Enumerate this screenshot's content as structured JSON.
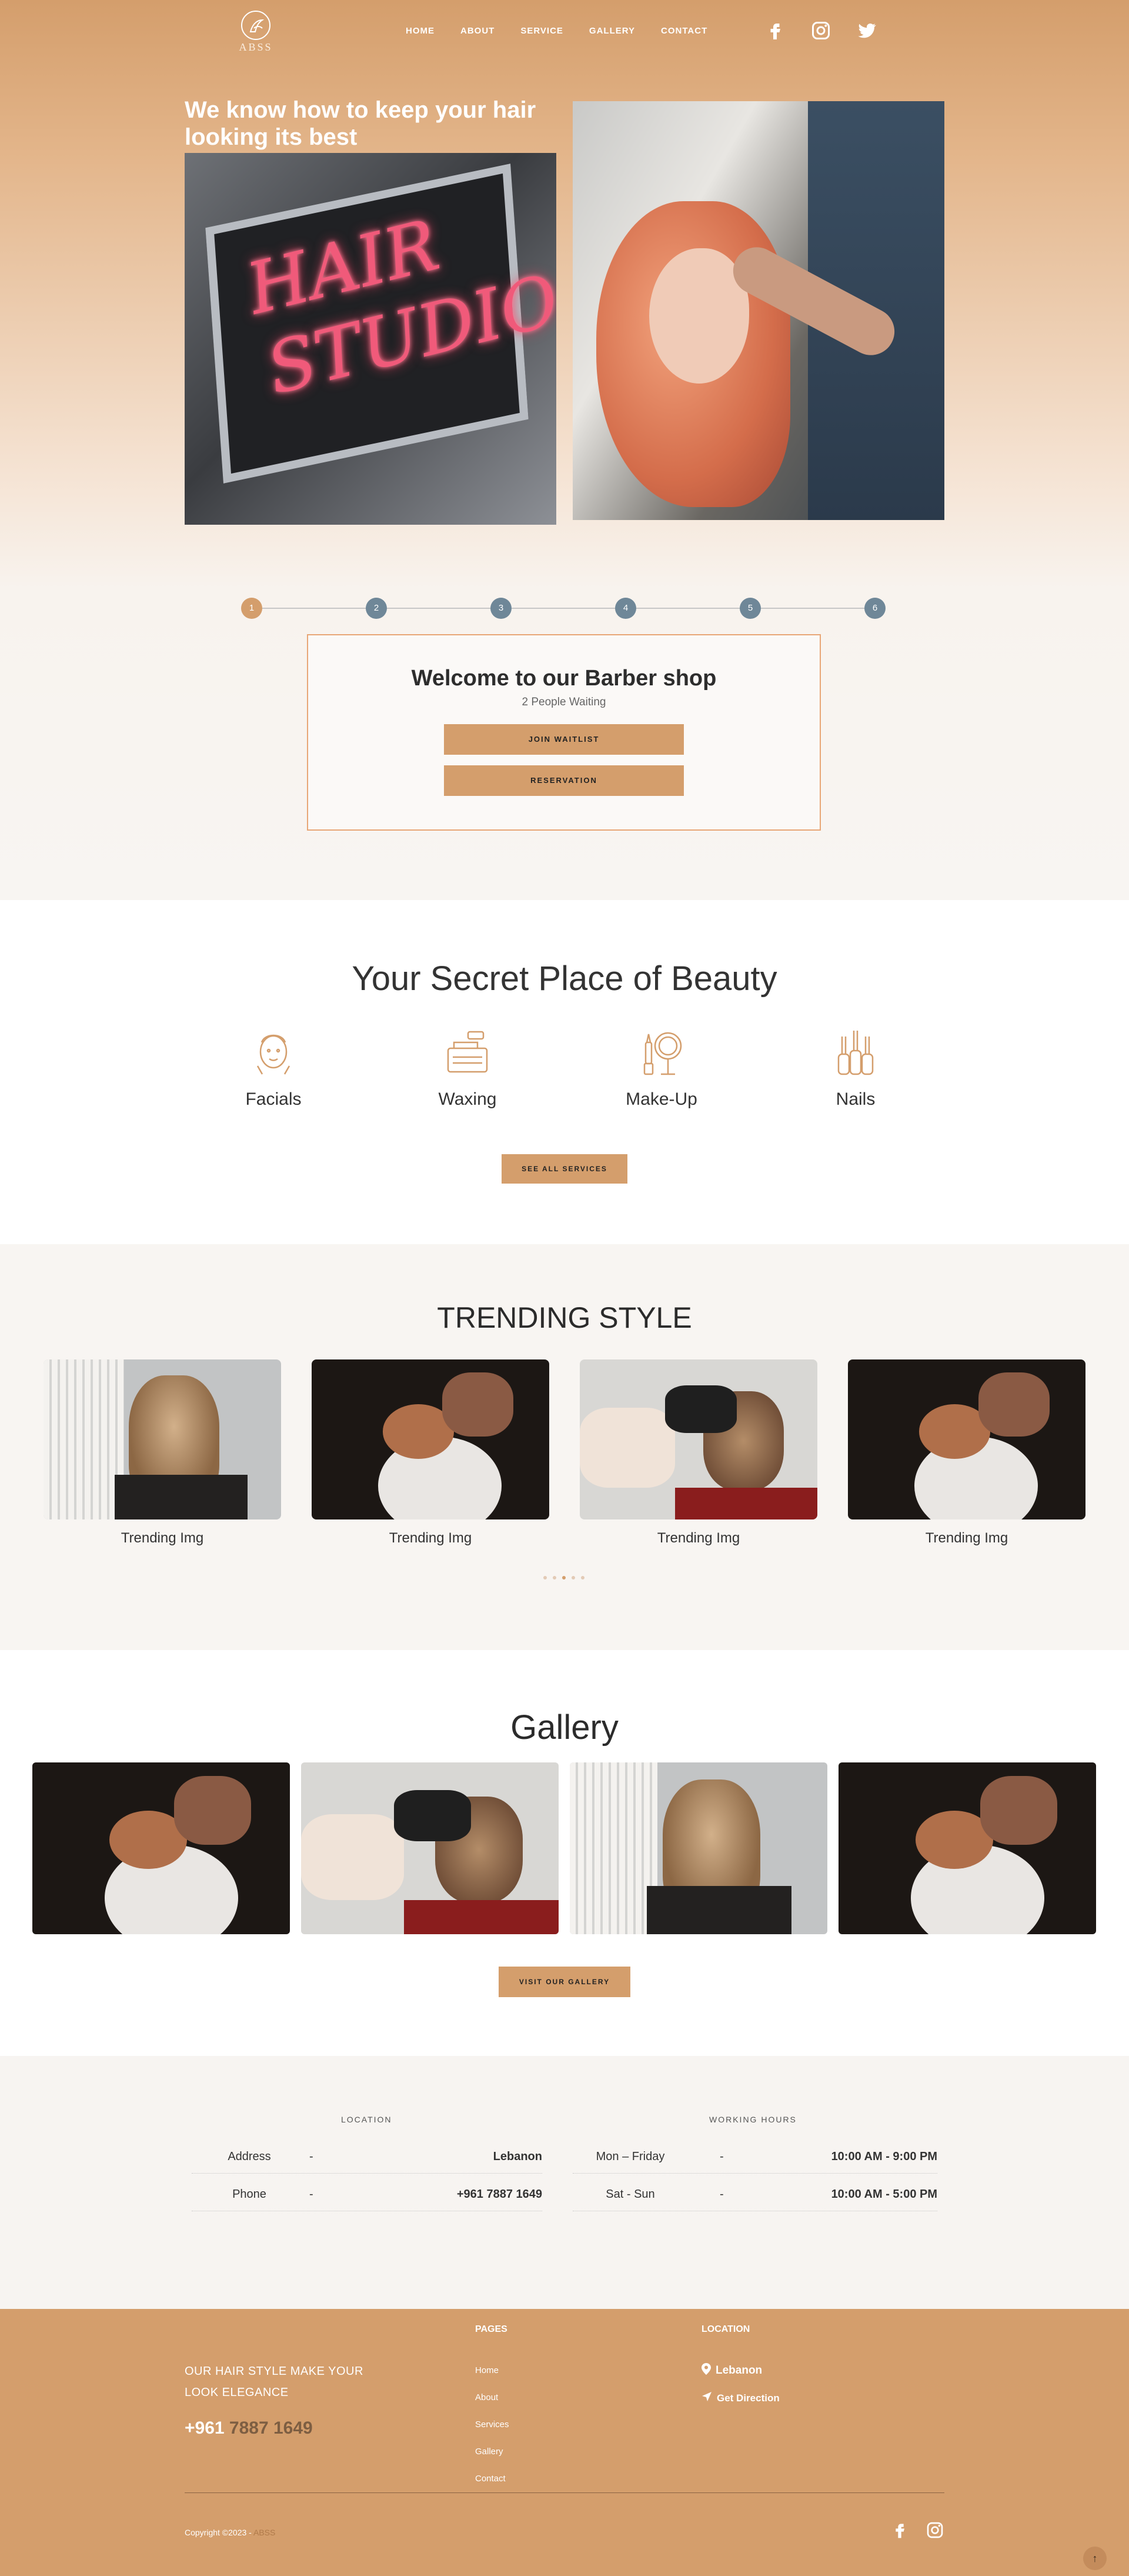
{
  "brand": {
    "logo_text": "ABSS"
  },
  "nav": {
    "items": [
      "HOME",
      "ABOUT",
      "SERVICE",
      "GALLERY",
      "CONTACT"
    ],
    "social_icons": [
      "facebook-icon",
      "instagram-icon",
      "twitter-icon"
    ]
  },
  "hero": {
    "heading": "We know how to keep your hair looking its best",
    "sign_text": "HAIR STUDIO"
  },
  "steps": {
    "items": [
      "1",
      "2",
      "3",
      "4",
      "5",
      "6"
    ],
    "active": 1
  },
  "welcome": {
    "title": "Welcome to our Barber shop",
    "waiting": "2 People Waiting",
    "join_label": "JOIN WAITLIST",
    "reservation_label": "RESERVATION"
  },
  "beauty": {
    "title": "Your Secret Place of Beauty",
    "services": [
      {
        "label": "Facials",
        "icon": "facial-icon"
      },
      {
        "label": "Waxing",
        "icon": "waxing-icon"
      },
      {
        "label": "Make-Up",
        "icon": "makeup-icon"
      },
      {
        "label": "Nails",
        "icon": "nails-icon"
      }
    ],
    "button_label": "SEE ALL SERVICES"
  },
  "trending": {
    "title": "TRENDING STYLE",
    "cards": [
      {
        "caption": "Trending Img"
      },
      {
        "caption": "Trending Img"
      },
      {
        "caption": "Trending Img"
      },
      {
        "caption": "Trending Img"
      }
    ],
    "pages": 5,
    "active_page": 3
  },
  "gallery": {
    "title": "Gallery",
    "button_label": "VISIT OUR GALLERY"
  },
  "info": {
    "location_title": "LOCATION",
    "hours_title": "WORKING HOURS",
    "location_rows": [
      {
        "key": "Address",
        "dash": "-",
        "value": "Lebanon"
      },
      {
        "key": "Phone",
        "dash": "-",
        "value": "+961 7887 1649"
      }
    ],
    "hours_rows": [
      {
        "key": "Mon – Friday",
        "dash": "-",
        "value": "10:00 AM - 9:00 PM"
      },
      {
        "key": "Sat - Sun",
        "dash": "-",
        "value": "10:00 AM - 5:00 PM"
      }
    ]
  },
  "footer": {
    "tagline": "OUR HAIR STYLE MAKE YOUR LOOK ELEGANCE",
    "phone_prefix": "+961",
    "phone_rest": "7887 1649",
    "pages_title": "PAGES",
    "pages": [
      "Home",
      "About",
      "Services",
      "Gallery",
      "Contact"
    ],
    "location_title": "LOCATION",
    "location_city": "Lebanon",
    "get_direction": "Get Direction",
    "copyright": "Copyright ©2023 -",
    "copyright_brand": "ABSS",
    "social_icons": [
      "facebook-icon",
      "instagram-icon"
    ],
    "to_top_icon": "arrow-up-icon"
  },
  "colors": {
    "accent": "#d49e6c",
    "step_inactive": "#6f8798",
    "text_dark": "#2b2b2b"
  }
}
